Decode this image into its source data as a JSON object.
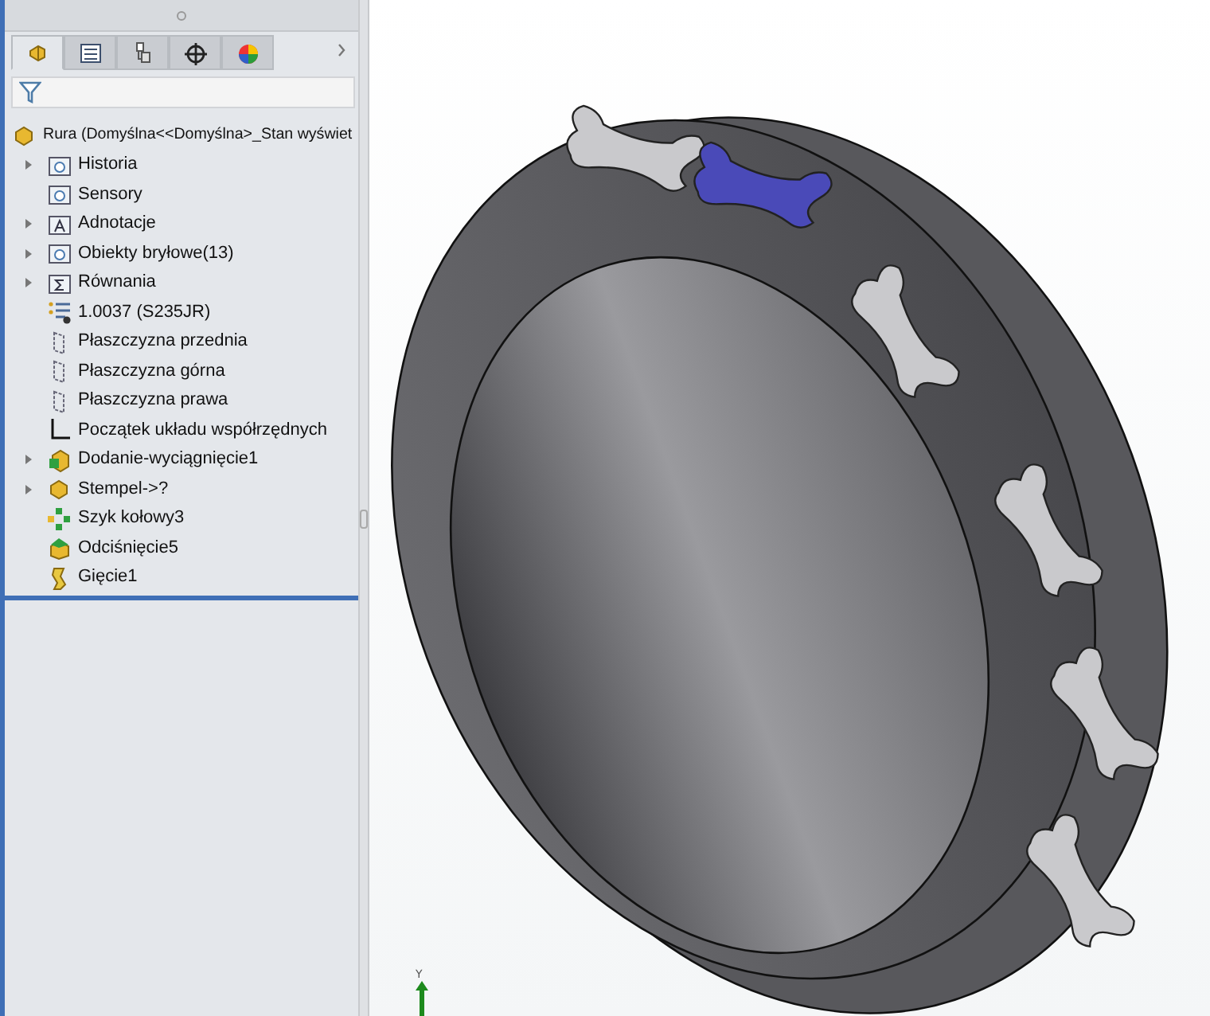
{
  "feature_manager": {
    "tabs": [
      {
        "kind": "features",
        "selected": true
      },
      {
        "kind": "properties",
        "selected": false
      },
      {
        "kind": "configurations",
        "selected": false
      },
      {
        "kind": "dimxpert",
        "selected": false
      },
      {
        "kind": "display",
        "selected": false
      }
    ],
    "root": {
      "label": "Rura  (Domyślna<<Domyślna>_Stan wyświet"
    },
    "items": [
      {
        "label": "Historia",
        "kind": "folder",
        "expandable": true
      },
      {
        "label": "Sensory",
        "kind": "folder",
        "expandable": false
      },
      {
        "label": "Adnotacje",
        "kind": "annotation",
        "expandable": true
      },
      {
        "label": "Obiekty bryłowe(13)",
        "kind": "folder",
        "expandable": true
      },
      {
        "label": "Równania",
        "kind": "equation",
        "expandable": true
      },
      {
        "label": "1.0037 (S235JR)",
        "kind": "material",
        "expandable": false
      },
      {
        "label": "Płaszczyzna przednia",
        "kind": "plane",
        "expandable": false
      },
      {
        "label": "Płaszczyzna górna",
        "kind": "plane",
        "expandable": false
      },
      {
        "label": "Płaszczyzna prawa",
        "kind": "plane",
        "expandable": false
      },
      {
        "label": "Początek układu współrzędnych",
        "kind": "origin",
        "expandable": false
      },
      {
        "label": "Dodanie-wyciągnięcie1",
        "kind": "extrude",
        "expandable": true
      },
      {
        "label": "Stempel->?",
        "kind": "part",
        "expandable": true
      },
      {
        "label": "Szyk kołowy3",
        "kind": "pattern",
        "expandable": false
      },
      {
        "label": "Odciśnięcie5",
        "kind": "indent",
        "expandable": false
      },
      {
        "label": "Gięcie1",
        "kind": "flex",
        "expandable": false
      }
    ]
  },
  "viewport": {
    "triad_axis": "Y"
  }
}
